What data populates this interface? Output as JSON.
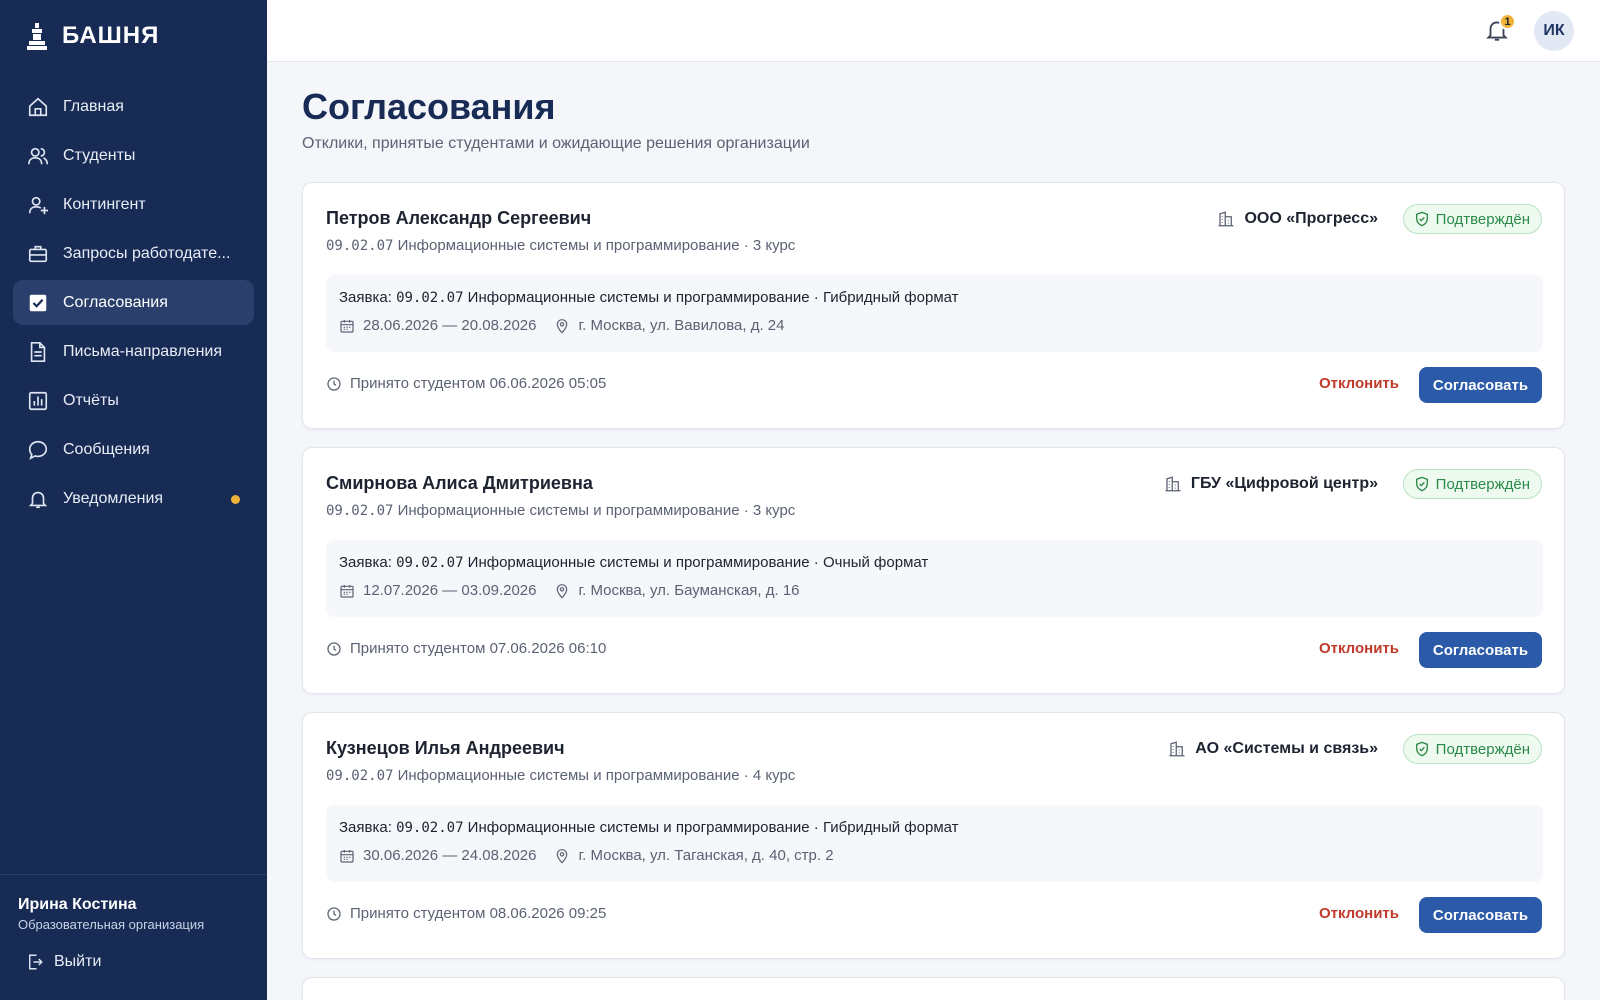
{
  "brand": {
    "name": "БАШНЯ"
  },
  "sidebar": {
    "items": [
      {
        "label": "Главная",
        "icon": "home-icon"
      },
      {
        "label": "Студенты",
        "icon": "users-icon"
      },
      {
        "label": "Контингент",
        "icon": "user-plus-icon"
      },
      {
        "label": "Запросы работодате...",
        "icon": "briefcase-icon"
      },
      {
        "label": "Согласования",
        "icon": "checkbox-icon",
        "active": true
      },
      {
        "label": "Письма-направления",
        "icon": "document-icon"
      },
      {
        "label": "Отчёты",
        "icon": "chart-icon"
      },
      {
        "label": "Сообщения",
        "icon": "chat-icon"
      },
      {
        "label": "Уведомления",
        "icon": "bell-icon",
        "dot": true
      }
    ],
    "user": {
      "name": "Ирина Костина",
      "role": "Образовательная организация"
    },
    "logout_label": "Выйти"
  },
  "topbar": {
    "notification_count": "1",
    "avatar_initials": "ИК"
  },
  "page": {
    "title": "Согласования",
    "subtitle": "Отклики, принятые студентами и ожидающие решения организации"
  },
  "cards": [
    {
      "student": "Петров Александр Сергеевич",
      "program_code": "09.02.07",
      "program_rest": " Информационные системы и программирование · 3 курс",
      "org": "ООО «Прогресс»",
      "status": "Подтверждён",
      "request_prefix": "Заявка: ",
      "request_code": "09.02.07",
      "request_rest": " Информационные системы и программирование · Гибридный формат",
      "dates": "28.06.2026 — 20.08.2026",
      "address": "г. Москва, ул. Вавилова, д. 24",
      "accepted": "Принято студентом 06.06.2026 05:05",
      "reject_label": "Отклонить",
      "approve_label": "Согласовать"
    },
    {
      "student": "Смирнова Алиса Дмитриевна",
      "program_code": "09.02.07",
      "program_rest": " Информационные системы и программирование · 3 курс",
      "org": "ГБУ «Цифровой центр»",
      "status": "Подтверждён",
      "request_prefix": "Заявка: ",
      "request_code": "09.02.07",
      "request_rest": " Информационные системы и программирование · Очный формат",
      "dates": "12.07.2026 — 03.09.2026",
      "address": "г. Москва, ул. Бауманская, д. 16",
      "accepted": "Принято студентом 07.06.2026 06:10",
      "reject_label": "Отклонить",
      "approve_label": "Согласовать"
    },
    {
      "student": "Кузнецов Илья Андреевич",
      "program_code": "09.02.07",
      "program_rest": " Информационные системы и программирование · 4 курс",
      "org": "АО «Системы и связь»",
      "status": "Подтверждён",
      "request_prefix": "Заявка: ",
      "request_code": "09.02.07",
      "request_rest": " Информационные системы и программирование · Гибридный формат",
      "dates": "30.06.2026 — 24.08.2026",
      "address": "г. Москва, ул. Таганская, д. 40, стр. 2",
      "accepted": "Принято студентом 08.06.2026 09:25",
      "reject_label": "Отклонить",
      "approve_label": "Согласовать"
    }
  ],
  "colors": {
    "sidebar_bg": "#172b55",
    "accent": "#2a5aa8",
    "reject": "#c0392b",
    "status_green": "#2a8a47",
    "badge": "#f0b33a"
  }
}
